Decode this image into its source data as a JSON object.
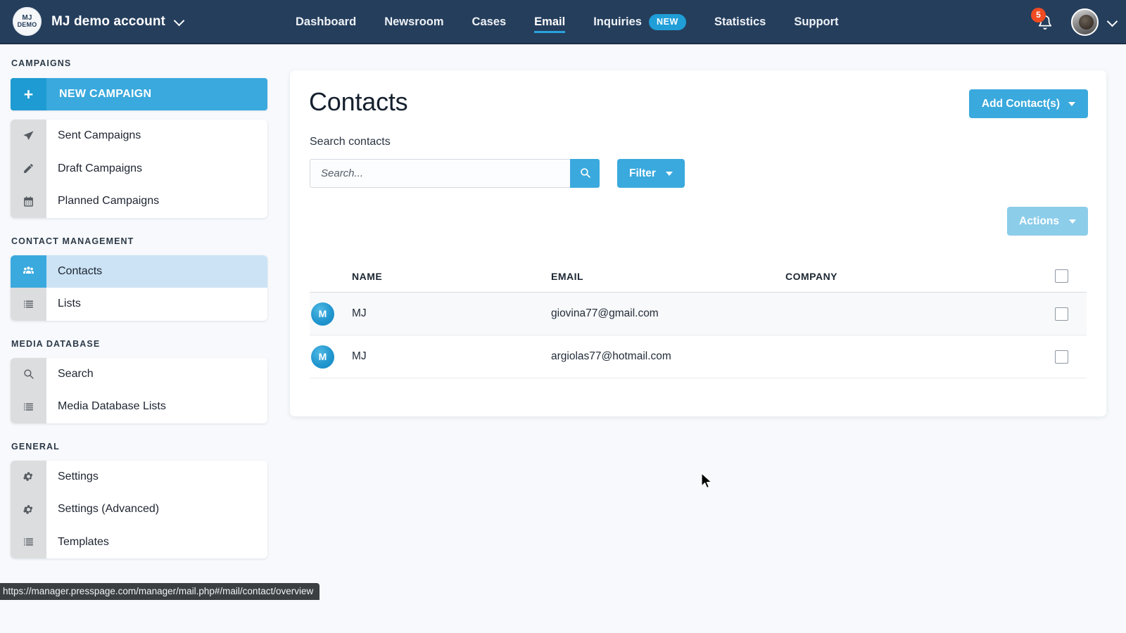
{
  "topnav": {
    "logo": {
      "line1": "MJ",
      "line2": "DEMO",
      "icon": "account-logo-icon"
    },
    "account_name": "MJ demo account",
    "links": [
      {
        "label": "Dashboard",
        "active": false,
        "badge": null
      },
      {
        "label": "Newsroom",
        "active": false,
        "badge": null
      },
      {
        "label": "Cases",
        "active": false,
        "badge": null
      },
      {
        "label": "Email",
        "active": true,
        "badge": null
      },
      {
        "label": "Inquiries",
        "active": false,
        "badge": "NEW"
      },
      {
        "label": "Statistics",
        "active": false,
        "badge": null
      },
      {
        "label": "Support",
        "active": false,
        "badge": null
      }
    ],
    "notification_count": "5",
    "bell_icon": "bell-icon",
    "avatar_icon": "user-avatar",
    "accent_color": "#3aa9dd",
    "bar_color": "#253e5c",
    "badge_color": "#f04b22"
  },
  "sidebar": {
    "new_campaign": {
      "label": "NEW CAMPAIGN",
      "icon": "plus-icon"
    },
    "groups": [
      {
        "heading": "CAMPAIGNS",
        "items": [
          {
            "label": "Sent Campaigns",
            "icon": "paper-plane-icon",
            "active": false
          },
          {
            "label": "Draft Campaigns",
            "icon": "pencil-icon",
            "active": false
          },
          {
            "label": "Planned Campaigns",
            "icon": "calendar-icon",
            "active": false
          }
        ]
      },
      {
        "heading": "CONTACT MANAGEMENT",
        "items": [
          {
            "label": "Contacts",
            "icon": "people-icon",
            "active": true
          },
          {
            "label": "Lists",
            "icon": "list-icon",
            "active": false
          }
        ]
      },
      {
        "heading": "MEDIA DATABASE",
        "items": [
          {
            "label": "Search",
            "icon": "search-icon",
            "active": false
          },
          {
            "label": "Media Database Lists",
            "icon": "list-icon",
            "active": false
          }
        ]
      },
      {
        "heading": "GENERAL",
        "items": [
          {
            "label": "Settings",
            "icon": "gear-icon",
            "active": false
          },
          {
            "label": "Settings (Advanced)",
            "icon": "gear-icon",
            "active": false
          },
          {
            "label": "Templates",
            "icon": "list-icon",
            "active": false
          }
        ]
      }
    ]
  },
  "main": {
    "title": "Contacts",
    "add_contacts_label": "Add Contact(s)",
    "search_label": "Search contacts",
    "search_placeholder": "Search...",
    "search_value": "",
    "search_icon": "search-icon",
    "filter_label": "Filter",
    "actions_label": "Actions",
    "table": {
      "headers": [
        "NAME",
        "EMAIL",
        "COMPANY"
      ],
      "select_all_checked": false,
      "rows": [
        {
          "avatar_initial": "M",
          "name": "MJ",
          "email": "giovina77@gmail.com",
          "company": "",
          "checked": false
        },
        {
          "avatar_initial": "M",
          "name": "MJ",
          "email": "argiolas77@hotmail.com",
          "company": "",
          "checked": false
        }
      ]
    }
  },
  "statusbar": {
    "url": "https://manager.presspage.com/manager/mail.php#/mail/contact/overview"
  }
}
